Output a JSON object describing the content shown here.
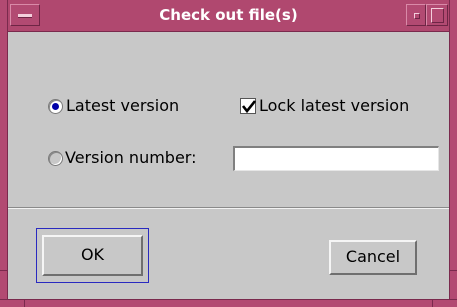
{
  "window": {
    "title": "Check out file(s)"
  },
  "options": {
    "latest_version_label": "Latest version",
    "latest_version_selected": true,
    "lock_latest_label": "Lock latest version",
    "lock_latest_checked": true,
    "version_number_label": "Version number:",
    "version_number_selected": false,
    "version_number_value": ""
  },
  "buttons": {
    "ok_label": "OK",
    "cancel_label": "Cancel"
  },
  "colors": {
    "titlebar": "#b0486f",
    "frame": "#b24a72",
    "dialog_bg": "#c8c8c8",
    "radio_selected": "#0000a8",
    "focus_ring": "#2a2ac0"
  }
}
